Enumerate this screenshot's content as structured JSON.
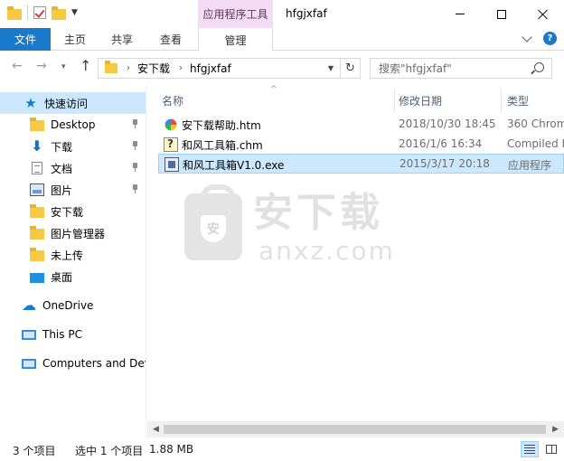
{
  "titlebar": {
    "context_header": "应用程序工具",
    "window_title": "hfgjxfaf"
  },
  "ribbon": {
    "tabs": [
      {
        "label": "文件"
      },
      {
        "label": "主页"
      },
      {
        "label": "共享"
      },
      {
        "label": "查看"
      },
      {
        "label": "管理"
      }
    ],
    "help_label": "?"
  },
  "address": {
    "breadcrumbs": [
      "安下载",
      "hfgjxfaf"
    ],
    "search_placeholder": "搜索\"hfgjxfaf\""
  },
  "navpane": {
    "quick_access": "快速访问",
    "items": [
      {
        "label": "Desktop",
        "icon": "folder-icon",
        "pinned": true
      },
      {
        "label": "下载",
        "icon": "download-icon",
        "pinned": true
      },
      {
        "label": "文档",
        "icon": "document-icon",
        "pinned": true
      },
      {
        "label": "图片",
        "icon": "pictures-icon",
        "pinned": true
      },
      {
        "label": "安下载",
        "icon": "folder-icon",
        "pinned": false
      },
      {
        "label": "图片管理器",
        "icon": "folder-icon",
        "pinned": false
      },
      {
        "label": "未上传",
        "icon": "folder-icon",
        "pinned": false
      },
      {
        "label": "桌面",
        "icon": "desktop-icon",
        "pinned": false
      }
    ],
    "onedrive": "OneDrive",
    "thispc": "This PC",
    "network": "Computers and Dev"
  },
  "content": {
    "columns": {
      "name": "名称",
      "date": "修改日期",
      "type": "类型"
    },
    "files": [
      {
        "name": "安下载帮助.htm",
        "date": "2018/10/30 18:45",
        "type": "360 Chrom",
        "icon": "html-file-icon",
        "selected": false
      },
      {
        "name": "和风工具箱.chm",
        "date": "2016/1/6 16:34",
        "type": "Compiled I",
        "icon": "chm-file-icon",
        "selected": false
      },
      {
        "name": "和风工具箱V1.0.exe",
        "date": "2015/3/17 20:18",
        "type": "应用程序",
        "icon": "exe-file-icon",
        "selected": true
      }
    ],
    "watermark": {
      "brand": "安下载",
      "domain": "anxz.com",
      "shield": "安"
    }
  },
  "statusbar": {
    "count": "3 个项目",
    "selected": "选中 1 个项目",
    "size": "1.88 MB"
  }
}
